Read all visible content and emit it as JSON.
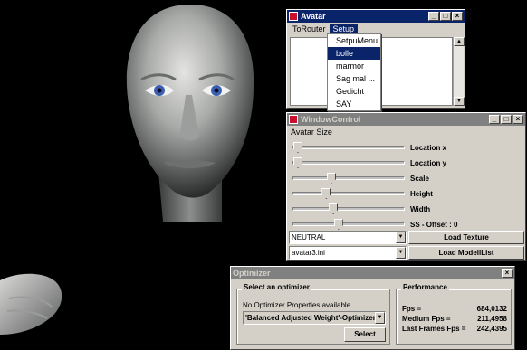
{
  "avatar_window": {
    "title": "Avatar",
    "menus": [
      "ToRouter",
      "Setup"
    ],
    "setup_menu_items": [
      "SetpuMenu",
      "bolle",
      "marmor",
      "Sag mal ...",
      "Gedicht",
      "SAY"
    ],
    "selected_item_index": 1
  },
  "window_control": {
    "title": "WindowControl",
    "section_label": "Avatar Size",
    "sliders": [
      {
        "label": "Location x",
        "value": 0.0
      },
      {
        "label": "Location y",
        "value": 0.0
      },
      {
        "label": "Scale",
        "value": 0.33
      },
      {
        "label": "Height",
        "value": 0.28
      },
      {
        "label": "Width",
        "value": 0.35
      },
      {
        "label": "SS - Offset : 0",
        "value": 0.4
      }
    ],
    "expression_combo": "NEUTRAL",
    "ini_combo": "avatar3.ini",
    "load_texture_label": "Load Texture",
    "load_modellist_label": "Load ModellList"
  },
  "optimizer": {
    "title": "Optimizer",
    "select_group_title": "Select an optimizer",
    "no_props_text": "No Optimizer Properties available",
    "optimizer_combo": "'Balanced Adjusted Weight'-Optimizer",
    "select_button": "Select",
    "performance_title": "Performance",
    "fps_label": "Fps =",
    "fps_value": "684,0132",
    "medium_fps_label": "Medium Fps =",
    "medium_fps_value": "211,4958",
    "last_frames_label": "Last Frames Fps =",
    "last_frames_value": "242,4395"
  },
  "colors": {
    "active_title": "#0a246a",
    "inactive_title": "#808080",
    "window_bg": "#d4d0c8"
  }
}
